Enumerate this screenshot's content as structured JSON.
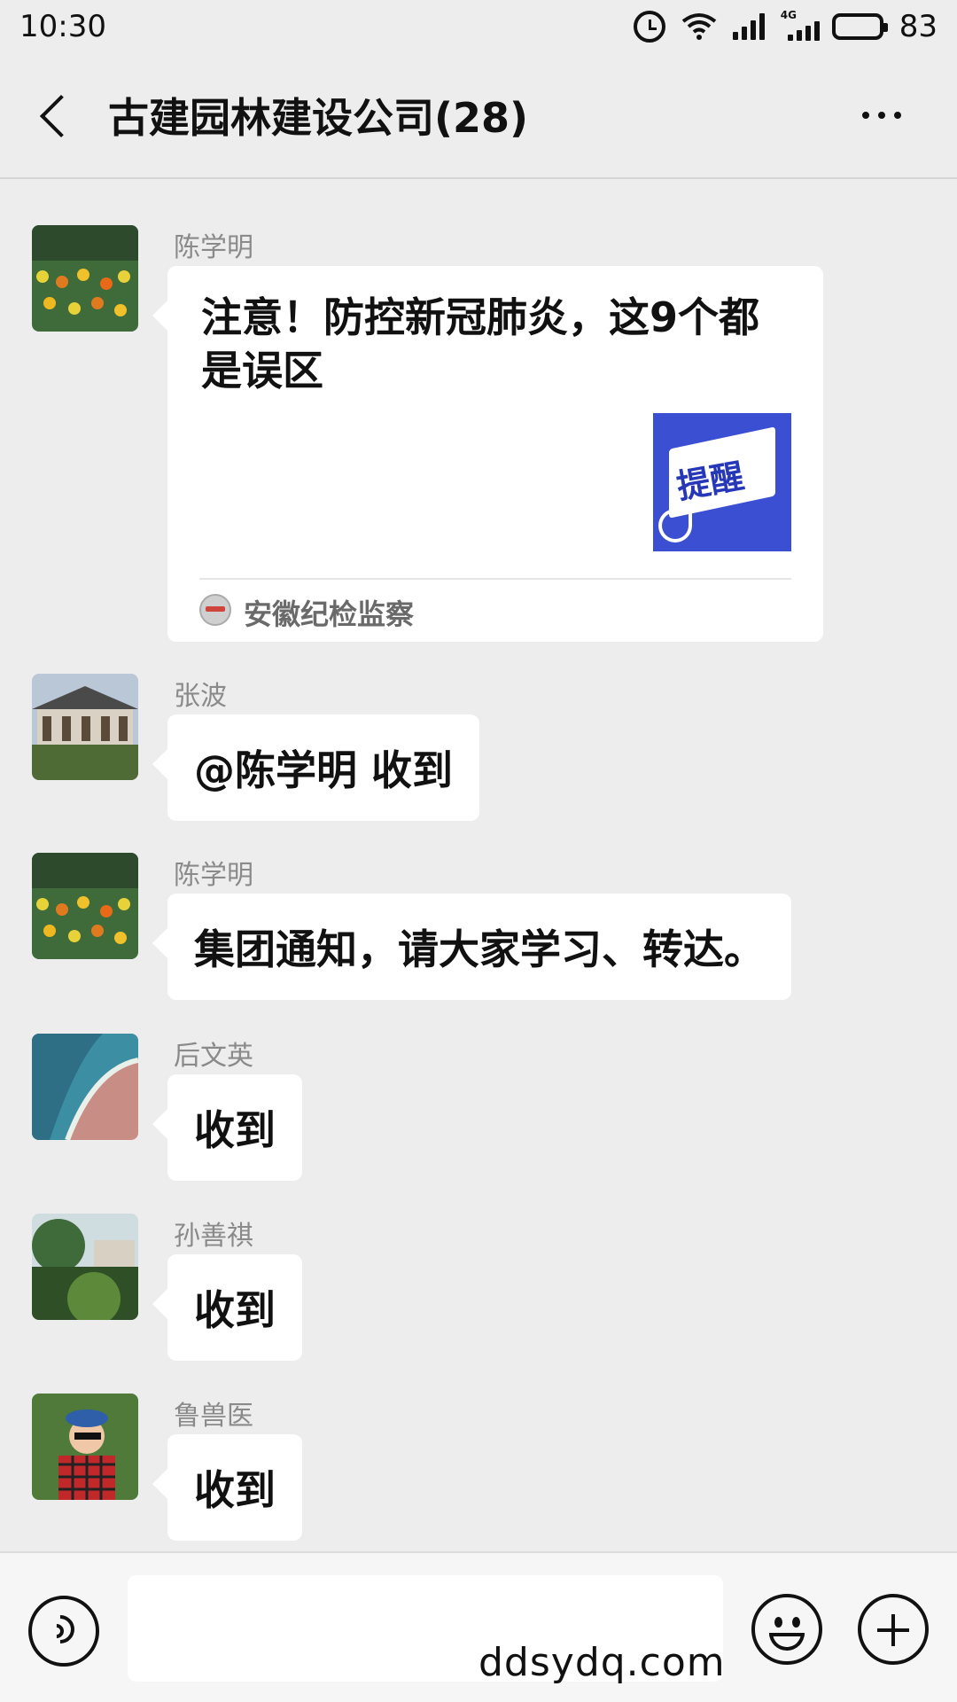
{
  "status_bar": {
    "time": "10:30",
    "network_label": "4G",
    "battery_percent": "83",
    "icons": [
      "alarm-icon",
      "wifi-icon",
      "signal-icon",
      "signal-4g-icon",
      "battery-icon"
    ]
  },
  "header": {
    "title": "古建园林建设公司(28)",
    "back_icon": "chevron-left-icon",
    "more_icon": "more-dots-icon"
  },
  "messages": [
    {
      "sender": "陈学明",
      "type": "link_card",
      "title": "注意！防控新冠肺炎，这9个都是误区",
      "thumbnail_text": "提醒",
      "source": "安徽纪检监察"
    },
    {
      "sender": "张波",
      "type": "text",
      "text": "@陈学明  收到"
    },
    {
      "sender": "陈学明",
      "type": "text",
      "text": "集团通知，请大家学习、转达。"
    },
    {
      "sender": "后文英",
      "type": "text",
      "text": "收到"
    },
    {
      "sender": "孙善祺",
      "type": "text",
      "text": "收到"
    },
    {
      "sender": "鲁兽医",
      "type": "text",
      "text": "收到"
    }
  ],
  "input_bar": {
    "voice_icon": "voice-icon",
    "input_value": "",
    "emoji_icon": "emoji-icon",
    "add_icon": "plus-circle-icon"
  },
  "watermark": "ddsydq.com",
  "colors": {
    "background": "#ededed",
    "bubble": "#ffffff",
    "sender_name": "#8a8a8a",
    "thumbnail_bg": "#3b4fd2"
  }
}
